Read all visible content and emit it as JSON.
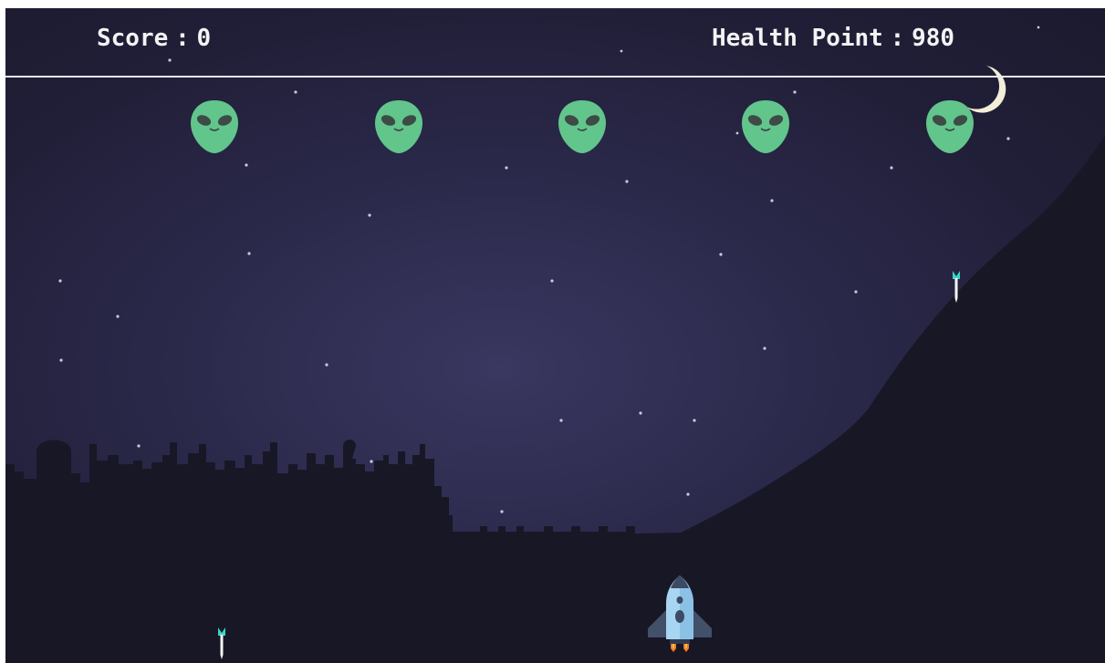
{
  "hud": {
    "score_label": "Score",
    "score_value": "0",
    "health_label": "Health Point",
    "health_value": "980",
    "separator": ":"
  },
  "colors": {
    "sky_dark": "#1b1a2e",
    "sky_mid": "#2c2a4c",
    "ground": "#181726",
    "alien_green": "#62c58c",
    "alien_eyes": "#3d4a45",
    "rocket_body": "#a7d5f2",
    "rocket_fins": "#42506a",
    "rocket_flame": "#f07a2a",
    "bullet_tip": "#3ad6c8",
    "moon": "#f2eed8",
    "hud_text": "#f3f3f3"
  },
  "icons": {
    "alien": "alien-face-icon",
    "player": "rocket-ship-icon",
    "projectile": "missile-icon",
    "moon": "crescent-moon-icon"
  },
  "aliens_count": 5,
  "bullets_count": 2
}
